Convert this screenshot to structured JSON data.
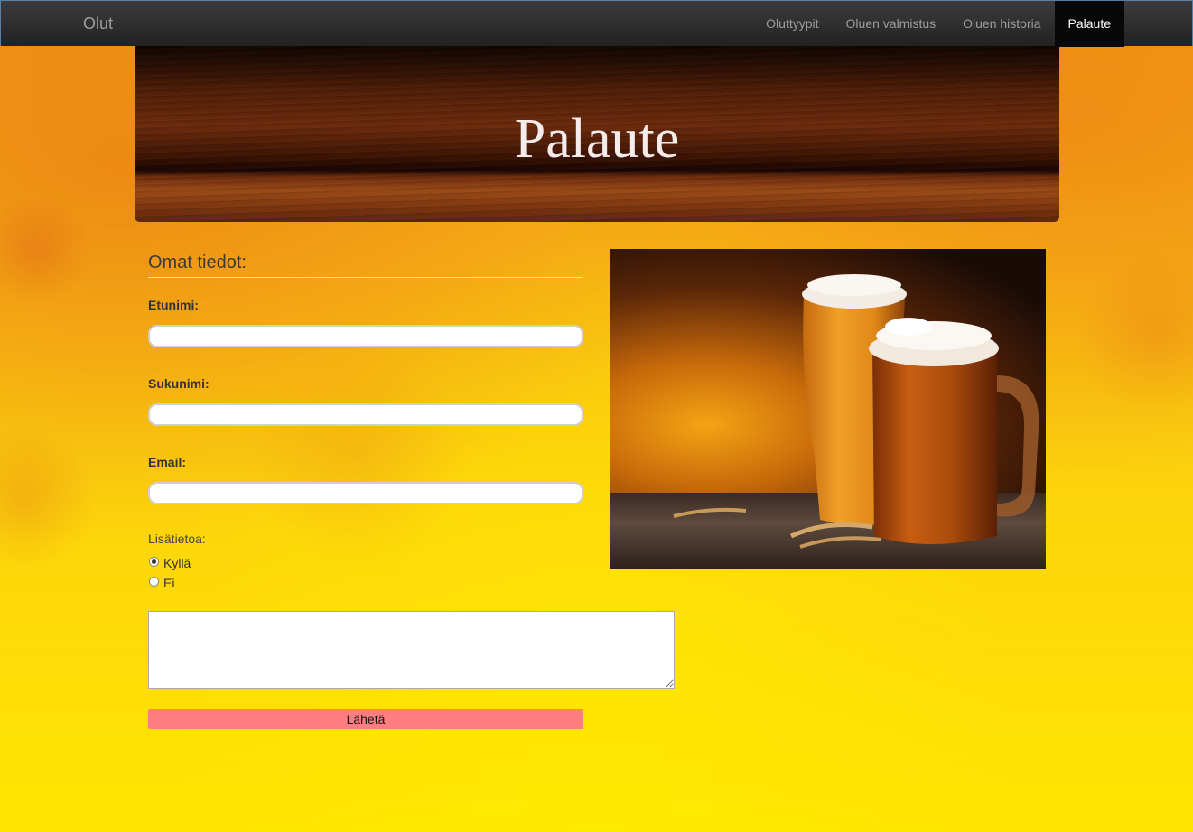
{
  "nav": {
    "brand": "Olut",
    "items": [
      {
        "label": "Oluttyypit",
        "active": false
      },
      {
        "label": "Oluen valmistus",
        "active": false
      },
      {
        "label": "Oluen historia",
        "active": false
      },
      {
        "label": "Palaute",
        "active": true
      }
    ]
  },
  "hero": {
    "title": "Palaute"
  },
  "form": {
    "heading": "Omat tiedot:",
    "first_name_label": "Etunimi:",
    "last_name_label": "Sukunimi:",
    "email_label": "Email:",
    "first_name_value": "",
    "last_name_value": "",
    "email_value": "",
    "extra_label": "Lisätietoa:",
    "radio_yes": "Kyllä",
    "radio_no": "Ei",
    "selected_radio": "yes",
    "message_value": "",
    "submit_label": "Lähetä"
  },
  "colors": {
    "submit_button": "#ff7c80",
    "nav_active_bg": "#080808"
  }
}
